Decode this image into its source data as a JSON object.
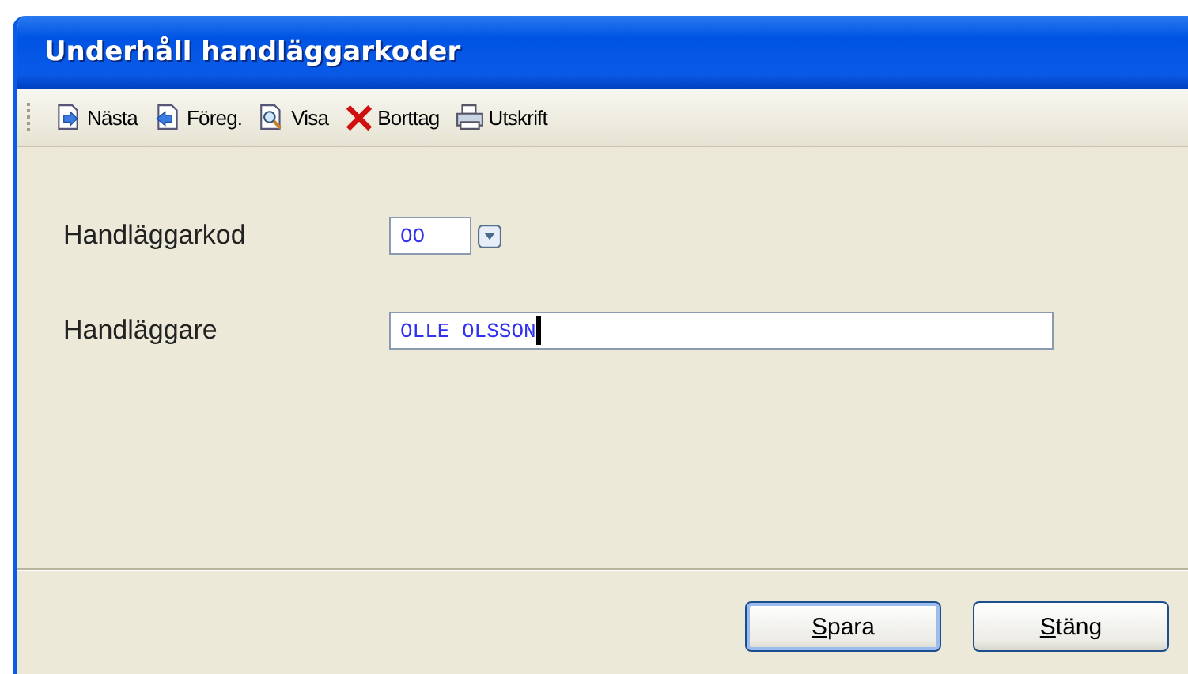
{
  "window": {
    "title": "Underhåll handläggarkoder"
  },
  "toolbar": [
    {
      "kind": "next",
      "label": "Nästa"
    },
    {
      "kind": "prev",
      "label": "Föreg."
    },
    {
      "kind": "view",
      "label": "Visa"
    },
    {
      "kind": "delete",
      "label": "Borttag"
    },
    {
      "kind": "print",
      "label": "Utskrift"
    }
  ],
  "fields": [
    {
      "kind": "code",
      "label": "Handläggarkod",
      "value": "OO"
    },
    {
      "kind": "text",
      "label": "Handläggare",
      "value": "OLLE OLSSON",
      "focused": true
    }
  ],
  "buttons": [
    {
      "label": "Spara",
      "default": true
    },
    {
      "label": "Stäng",
      "default": false
    }
  ]
}
